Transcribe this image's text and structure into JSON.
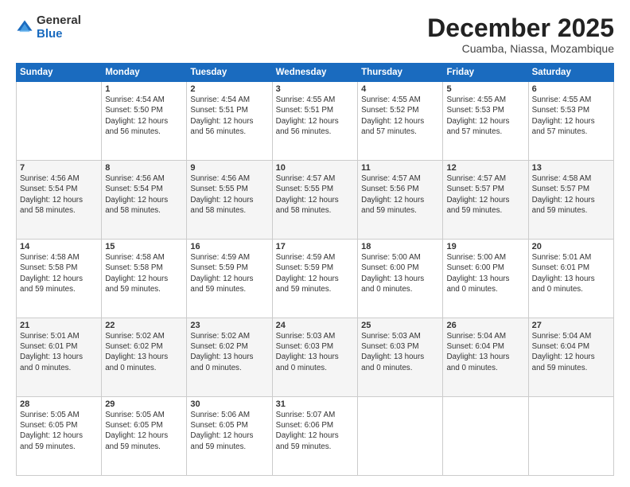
{
  "header": {
    "logo": {
      "general": "General",
      "blue": "Blue"
    },
    "title": "December 2025",
    "subtitle": "Cuamba, Niassa, Mozambique"
  },
  "calendar": {
    "days_header": [
      "Sunday",
      "Monday",
      "Tuesday",
      "Wednesday",
      "Thursday",
      "Friday",
      "Saturday"
    ],
    "weeks": [
      [
        {
          "day": "",
          "info": ""
        },
        {
          "day": "1",
          "info": "Sunrise: 4:54 AM\nSunset: 5:50 PM\nDaylight: 12 hours\nand 56 minutes."
        },
        {
          "day": "2",
          "info": "Sunrise: 4:54 AM\nSunset: 5:51 PM\nDaylight: 12 hours\nand 56 minutes."
        },
        {
          "day": "3",
          "info": "Sunrise: 4:55 AM\nSunset: 5:51 PM\nDaylight: 12 hours\nand 56 minutes."
        },
        {
          "day": "4",
          "info": "Sunrise: 4:55 AM\nSunset: 5:52 PM\nDaylight: 12 hours\nand 57 minutes."
        },
        {
          "day": "5",
          "info": "Sunrise: 4:55 AM\nSunset: 5:53 PM\nDaylight: 12 hours\nand 57 minutes."
        },
        {
          "day": "6",
          "info": "Sunrise: 4:55 AM\nSunset: 5:53 PM\nDaylight: 12 hours\nand 57 minutes."
        }
      ],
      [
        {
          "day": "7",
          "info": "Sunrise: 4:56 AM\nSunset: 5:54 PM\nDaylight: 12 hours\nand 58 minutes."
        },
        {
          "day": "8",
          "info": "Sunrise: 4:56 AM\nSunset: 5:54 PM\nDaylight: 12 hours\nand 58 minutes."
        },
        {
          "day": "9",
          "info": "Sunrise: 4:56 AM\nSunset: 5:55 PM\nDaylight: 12 hours\nand 58 minutes."
        },
        {
          "day": "10",
          "info": "Sunrise: 4:57 AM\nSunset: 5:55 PM\nDaylight: 12 hours\nand 58 minutes."
        },
        {
          "day": "11",
          "info": "Sunrise: 4:57 AM\nSunset: 5:56 PM\nDaylight: 12 hours\nand 59 minutes."
        },
        {
          "day": "12",
          "info": "Sunrise: 4:57 AM\nSunset: 5:57 PM\nDaylight: 12 hours\nand 59 minutes."
        },
        {
          "day": "13",
          "info": "Sunrise: 4:58 AM\nSunset: 5:57 PM\nDaylight: 12 hours\nand 59 minutes."
        }
      ],
      [
        {
          "day": "14",
          "info": "Sunrise: 4:58 AM\nSunset: 5:58 PM\nDaylight: 12 hours\nand 59 minutes."
        },
        {
          "day": "15",
          "info": "Sunrise: 4:58 AM\nSunset: 5:58 PM\nDaylight: 12 hours\nand 59 minutes."
        },
        {
          "day": "16",
          "info": "Sunrise: 4:59 AM\nSunset: 5:59 PM\nDaylight: 12 hours\nand 59 minutes."
        },
        {
          "day": "17",
          "info": "Sunrise: 4:59 AM\nSunset: 5:59 PM\nDaylight: 12 hours\nand 59 minutes."
        },
        {
          "day": "18",
          "info": "Sunrise: 5:00 AM\nSunset: 6:00 PM\nDaylight: 13 hours\nand 0 minutes."
        },
        {
          "day": "19",
          "info": "Sunrise: 5:00 AM\nSunset: 6:00 PM\nDaylight: 13 hours\nand 0 minutes."
        },
        {
          "day": "20",
          "info": "Sunrise: 5:01 AM\nSunset: 6:01 PM\nDaylight: 13 hours\nand 0 minutes."
        }
      ],
      [
        {
          "day": "21",
          "info": "Sunrise: 5:01 AM\nSunset: 6:01 PM\nDaylight: 13 hours\nand 0 minutes."
        },
        {
          "day": "22",
          "info": "Sunrise: 5:02 AM\nSunset: 6:02 PM\nDaylight: 13 hours\nand 0 minutes."
        },
        {
          "day": "23",
          "info": "Sunrise: 5:02 AM\nSunset: 6:02 PM\nDaylight: 13 hours\nand 0 minutes."
        },
        {
          "day": "24",
          "info": "Sunrise: 5:03 AM\nSunset: 6:03 PM\nDaylight: 13 hours\nand 0 minutes."
        },
        {
          "day": "25",
          "info": "Sunrise: 5:03 AM\nSunset: 6:03 PM\nDaylight: 13 hours\nand 0 minutes."
        },
        {
          "day": "26",
          "info": "Sunrise: 5:04 AM\nSunset: 6:04 PM\nDaylight: 13 hours\nand 0 minutes."
        },
        {
          "day": "27",
          "info": "Sunrise: 5:04 AM\nSunset: 6:04 PM\nDaylight: 12 hours\nand 59 minutes."
        }
      ],
      [
        {
          "day": "28",
          "info": "Sunrise: 5:05 AM\nSunset: 6:05 PM\nDaylight: 12 hours\nand 59 minutes."
        },
        {
          "day": "29",
          "info": "Sunrise: 5:05 AM\nSunset: 6:05 PM\nDaylight: 12 hours\nand 59 minutes."
        },
        {
          "day": "30",
          "info": "Sunrise: 5:06 AM\nSunset: 6:05 PM\nDaylight: 12 hours\nand 59 minutes."
        },
        {
          "day": "31",
          "info": "Sunrise: 5:07 AM\nSunset: 6:06 PM\nDaylight: 12 hours\nand 59 minutes."
        },
        {
          "day": "",
          "info": ""
        },
        {
          "day": "",
          "info": ""
        },
        {
          "day": "",
          "info": ""
        }
      ]
    ]
  }
}
